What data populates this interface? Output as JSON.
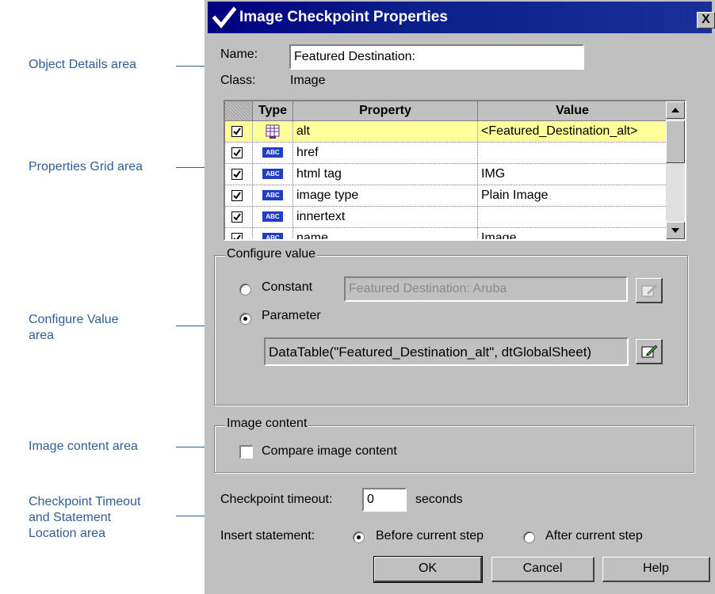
{
  "annotations": [
    {
      "id": "object-details",
      "text": "Object Details area"
    },
    {
      "id": "properties-grid",
      "text": "Properties Grid area"
    },
    {
      "id": "configure-value",
      "lines": [
        "Configure Value",
        "area"
      ]
    },
    {
      "id": "image-content",
      "text": "Image content area"
    },
    {
      "id": "checkpoint-timeout",
      "lines": [
        "Checkpoint Timeout",
        "and Statement",
        "Location area"
      ]
    }
  ],
  "dialog": {
    "title": "Image Checkpoint Properties",
    "close_label": "X",
    "name_label": "Name:",
    "name_value": "Featured Destination:",
    "class_label": "Class:",
    "class_value": "Image"
  },
  "grid": {
    "columns": {
      "type": "Type",
      "property": "Property",
      "value": "Value"
    },
    "rows": [
      {
        "checked": true,
        "type_icon": "table-icon",
        "property": "alt",
        "value": "<Featured_Destination_alt>",
        "selected": true
      },
      {
        "checked": true,
        "type_icon": "abc-icon",
        "property": "href",
        "value": ""
      },
      {
        "checked": true,
        "type_icon": "abc-icon",
        "property": "html tag",
        "value": "IMG"
      },
      {
        "checked": true,
        "type_icon": "abc-icon",
        "property": "image type",
        "value": "Plain Image"
      },
      {
        "checked": true,
        "type_icon": "abc-icon",
        "property": "innertext",
        "value": ""
      },
      {
        "checked": true,
        "type_icon": "abc-icon",
        "property": "name",
        "value": "Image"
      }
    ],
    "abc_text": "ABC"
  },
  "configure": {
    "legend": "Configure value",
    "constant_label": "Constant",
    "constant_value": "Featured Destination: Aruba",
    "parameter_label": "Parameter",
    "parameter_value": "DataTable(\"Featured_Destination_alt\", dtGlobalSheet)",
    "selected": "parameter"
  },
  "image_content": {
    "legend": "Image content",
    "compare_label": "Compare image content",
    "compare_checked": false
  },
  "timeout": {
    "label": "Checkpoint timeout:",
    "value": "0",
    "unit": "seconds"
  },
  "insert": {
    "label": "Insert statement:",
    "before_label": "Before current step",
    "after_label": "After current step",
    "selected": "before"
  },
  "buttons": {
    "ok": "OK",
    "cancel": "Cancel",
    "help": "Help"
  },
  "colors": {
    "annotation": "#2f5e96",
    "title_bar": "#000080",
    "selected_row": "#ffff99",
    "dialog_bg": "#c0c0c0"
  }
}
